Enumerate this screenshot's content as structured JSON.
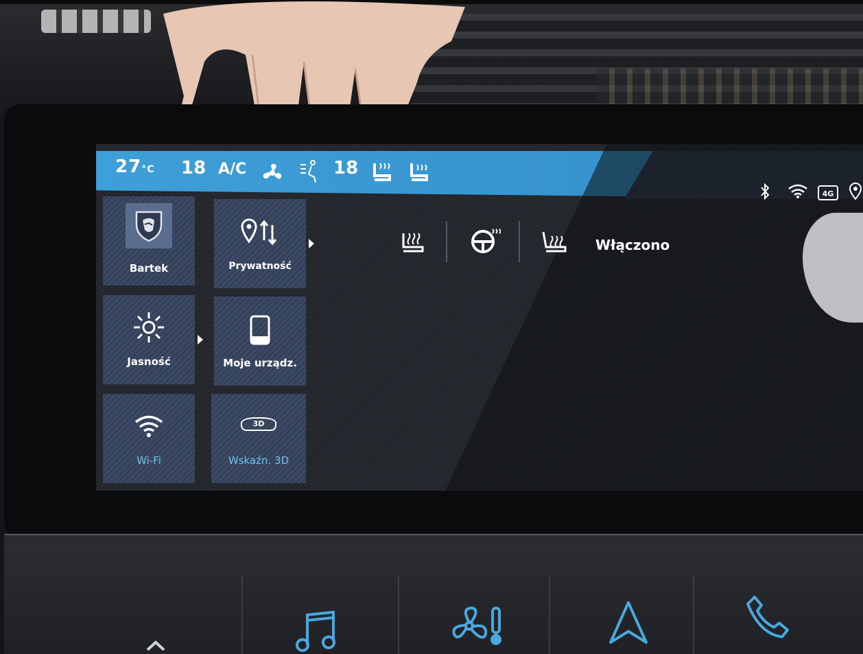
{
  "status_bar": {
    "outside_temp": "27",
    "outside_temp_unit": "°C",
    "driver_temp": "18",
    "ac_label": "A/C",
    "passenger_temp": "18"
  },
  "tiles": [
    {
      "label": "Bartek",
      "icon": "peugeot-lion-icon"
    },
    {
      "label": "Prywatność",
      "icon": "location-privacy-icon"
    },
    {
      "label": "Jasność",
      "icon": "brightness-sun-icon"
    },
    {
      "label": "Moje urządz.",
      "icon": "phone-device-icon"
    },
    {
      "label": "Wi-Fi",
      "icon": "wifi-icon"
    },
    {
      "label": "Wskaźn. 3D",
      "icon": "3d-display-icon"
    }
  ],
  "tile_3d_badge": "3D",
  "comfort": {
    "status_text": "Włączono",
    "icons": [
      "seat-heat-icon",
      "steering-wheel-heat-icon",
      "rear-seat-heat-icon"
    ]
  },
  "tray_icons": [
    "bluetooth-icon",
    "wifi-signal-icon",
    "4g-icon",
    "location-icon"
  ],
  "tray_4g_label": "4G",
  "touch_bar_icons": [
    "music-icon",
    "climate-fan-icon",
    "navigation-icon",
    "phone-icon"
  ],
  "colors": {
    "status_blue": "#3f9fd8",
    "tile_bg": "#3c4a66",
    "accent_blue": "#6cc3f2",
    "touch_icon_blue": "#4aa8e0"
  }
}
